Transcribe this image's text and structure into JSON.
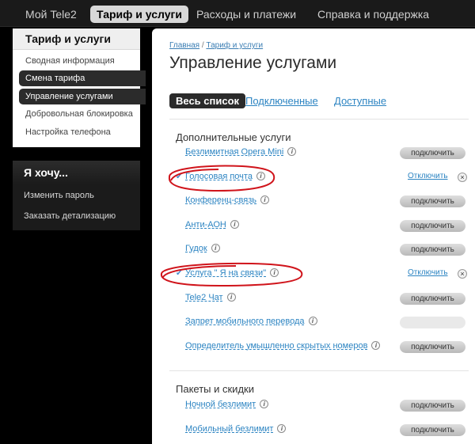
{
  "topnav": {
    "items": [
      "Мой Tele2",
      "Тариф и услуги",
      "Расходы и платежи",
      "Справка и поддержка"
    ]
  },
  "sidebar": {
    "title": "Тариф и услуги",
    "items": [
      "Сводная информация",
      "Смена тарифа",
      "Управление услугами",
      "Добровольная блокировка",
      "Настройка телефона"
    ]
  },
  "want": {
    "title": "Я хочу...",
    "items": [
      "Изменить пароль",
      "Заказать детализацию"
    ]
  },
  "main": {
    "breadcrumb": {
      "home": "Главная",
      "sep": " / ",
      "current": "Тариф и услуги"
    },
    "title": "Управление услугами",
    "tabs": [
      "Весь список",
      "Подключенные",
      "Доступные"
    ],
    "section1": "Дополнительные услуги",
    "section2": "Пакеты и скидки",
    "info_glyph": "i",
    "connect_label": "подключить",
    "disconnect_label": "Отключить",
    "remove_glyph": "×",
    "services": [
      {
        "name": "Безлимитная Opera Mini",
        "state": "available"
      },
      {
        "name": "Голосовая почта",
        "state": "connected"
      },
      {
        "name": "Конференц-связь",
        "state": "available"
      },
      {
        "name": "Анти-АОН",
        "state": "available"
      },
      {
        "name": "Гудок",
        "state": "available"
      },
      {
        "name": "Услуга \" Я на связи\"",
        "state": "connected"
      },
      {
        "name": "Tele2 Чат",
        "state": "available"
      },
      {
        "name": "Запрет мобильного перевода",
        "state": "disabled"
      },
      {
        "name": "Определитель умышленно скрытых номеров",
        "state": "available"
      }
    ],
    "packages": [
      {
        "name": "Ночной безлимит",
        "state": "available"
      },
      {
        "name": "Мобильный безлимит",
        "state": "available"
      }
    ]
  },
  "colors": {
    "background": "#000000",
    "link": "#2c84c2",
    "annotation": "#d0141b"
  }
}
